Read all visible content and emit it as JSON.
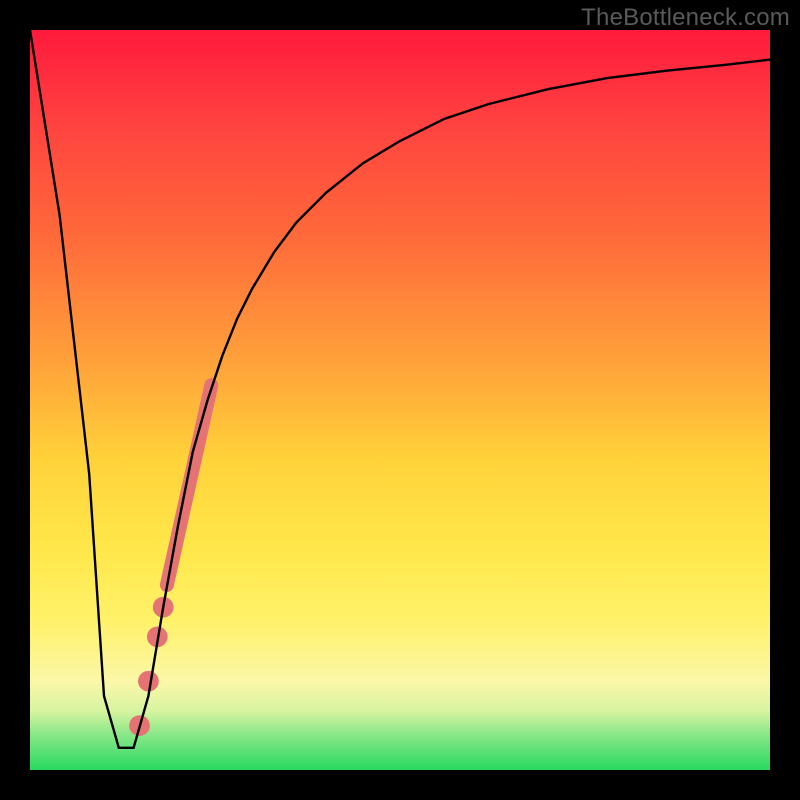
{
  "watermark": "TheBottleneck.com",
  "chart_data": {
    "type": "line",
    "title": "",
    "xlabel": "",
    "ylabel": "",
    "xlim": [
      0,
      100
    ],
    "ylim": [
      0,
      100
    ],
    "grid": false,
    "series": [
      {
        "name": "bottleneck-curve",
        "x": [
          0,
          4,
          8,
          10,
          12,
          14,
          16,
          18,
          20,
          22,
          24,
          26,
          28,
          30,
          33,
          36,
          40,
          45,
          50,
          56,
          62,
          70,
          78,
          86,
          94,
          100
        ],
        "y": [
          100,
          75,
          40,
          10,
          3,
          3,
          10,
          22,
          33,
          43,
          50,
          56,
          61,
          65,
          70,
          74,
          78,
          82,
          85,
          88,
          90,
          92,
          93.5,
          94.5,
          95.3,
          96
        ]
      }
    ],
    "markers": [
      {
        "name": "highlight-segment",
        "shape": "line",
        "x0": 18.5,
        "y0": 25,
        "x1": 24.5,
        "y1": 52,
        "stroke": "#e57373",
        "width": 14
      },
      {
        "name": "dot-1",
        "shape": "circle",
        "cx": 17.2,
        "cy": 18,
        "r": 1.4,
        "fill": "#e57373"
      },
      {
        "name": "dot-2",
        "shape": "circle",
        "cx": 16.0,
        "cy": 12,
        "r": 1.4,
        "fill": "#e57373"
      },
      {
        "name": "dot-3",
        "shape": "circle",
        "cx": 14.8,
        "cy": 6,
        "r": 1.4,
        "fill": "#e57373"
      },
      {
        "name": "dot-4",
        "shape": "circle",
        "cx": 18.0,
        "cy": 22,
        "r": 1.4,
        "fill": "#e57373"
      }
    ]
  }
}
